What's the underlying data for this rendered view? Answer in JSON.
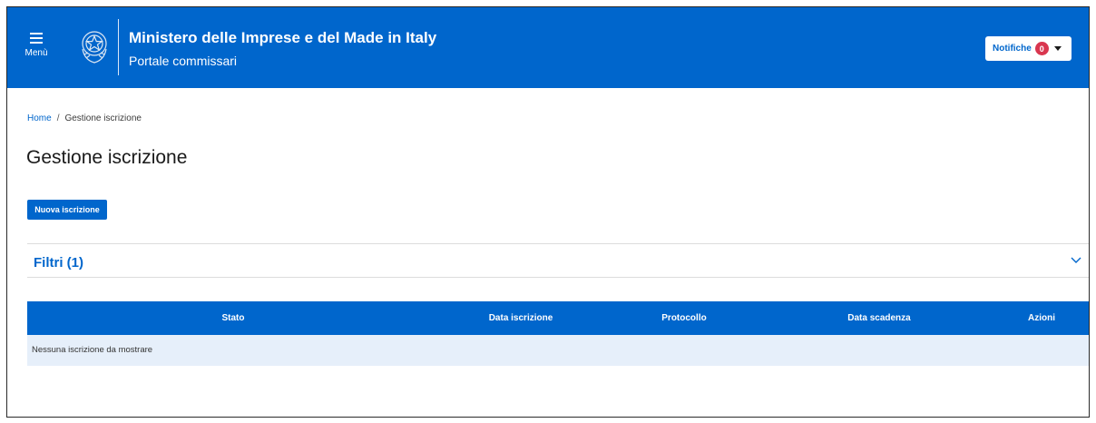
{
  "header": {
    "menu_label": "Menù",
    "title": "Ministero delle Imprese e del Made in Italy",
    "subtitle": "Portale commissari",
    "notifications": {
      "label": "Notifiche",
      "count": "0"
    }
  },
  "breadcrumb": {
    "home": "Home",
    "separator": "/",
    "current": "Gestione iscrizione"
  },
  "page": {
    "title": "Gestione iscrizione",
    "new_button": "Nuova iscrizione",
    "filters_label": "Filtri (1)"
  },
  "table": {
    "columns": [
      "Stato",
      "Data iscrizione",
      "Protocollo",
      "Data scadenza",
      "Azioni"
    ],
    "empty_message": "Nessuna iscrizione da mostrare"
  },
  "colors": {
    "primary": "#0066cc",
    "badge": "#d9364f",
    "row_bg": "#e6effa"
  },
  "icons": {
    "menu": "hamburger-icon",
    "emblem": "italian-republic-emblem",
    "filters": "chevron-down-icon",
    "dropdown": "caret-down-icon"
  }
}
